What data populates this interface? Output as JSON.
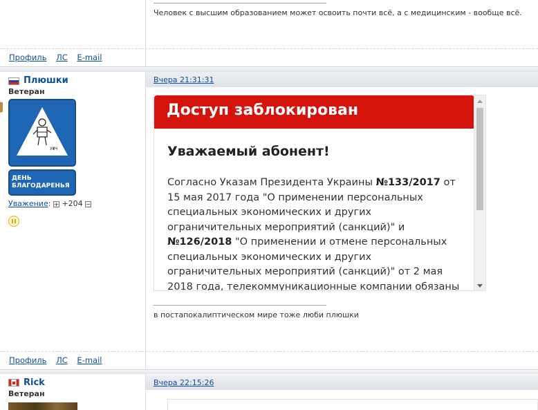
{
  "post1": {
    "signature": "Человек с высшим образованием может освоить почти всё, а с медицинским - вообще всё.",
    "footer_links": {
      "profile": "Профиль",
      "pm": "ЛС",
      "email": "E-mail"
    }
  },
  "post2": {
    "date": "Вчера 21:31:31",
    "username": "Плюшки",
    "rank": "Ветеран",
    "avatar_sign": "УЖЧ",
    "badge_text_1": "ДЕНЬ",
    "badge_text_2": "БЛАГОДАРЕНЬЯ",
    "respect_label": "Уважение",
    "respect_colon": ":",
    "respect_plus": "+",
    "respect_value": "+204",
    "respect_minus": "−",
    "blocked": {
      "title": "Доступ заблокирован",
      "subtitle": "Уважаемый абонент!",
      "text_1": "Согласно Указам Президента Украины ",
      "decree_1": "№133/2017",
      "text_2": " от 15 мая 2017 года \"О применении персональных специальных экономических и других ограничительных мероприятий (санкций)\" и ",
      "decree_2": "№126/2018",
      "text_3": " \"О применении и отмене персональных специальных экономических и других ограничительных мероприятий (санкций)\" от 2 мая 2018 года, телекоммуникационные компании обязаны прекратить доступ к ряду веб-ресурсов, в том"
    },
    "signature": "в постапокалиптическом мире тоже люби плюшки",
    "footer_links": {
      "profile": "Профиль",
      "pm": "ЛС",
      "email": "E-mail"
    }
  },
  "post3": {
    "date": "Вчера 22:15:26",
    "username": "Rick",
    "rank": "Ветеран"
  },
  "colors": {
    "link": "#0b4f9e",
    "blocked_header": "#d4140c",
    "badge_blue": "#1e66b3"
  },
  "icons": [
    "flag-russia-icon",
    "flag-canada-icon",
    "plus-box-icon",
    "minus-box-icon",
    "pause-status-icon",
    "scroll-up-icon",
    "scroll-down-icon"
  ]
}
